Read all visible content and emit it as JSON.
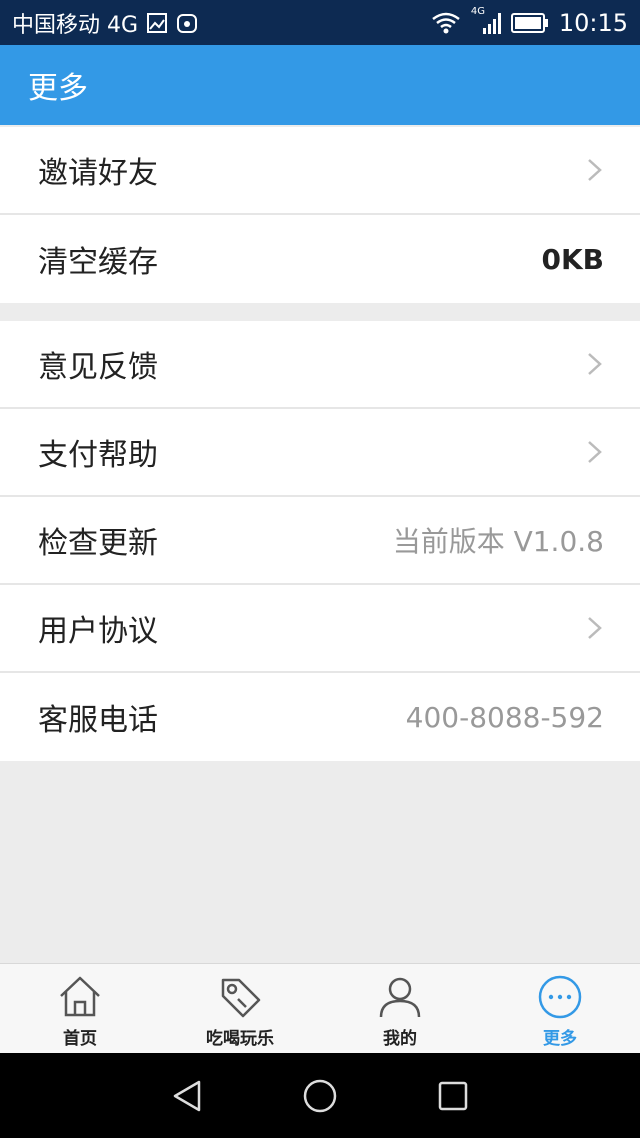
{
  "status_bar": {
    "carrier": "中国移动 4G",
    "time": "10:15",
    "net_small": "4G",
    "icons": [
      "image-icon",
      "app-notification-icon",
      "wifi-icon",
      "signal-icon",
      "battery-icon"
    ]
  },
  "header": {
    "title": "更多"
  },
  "groups": [
    {
      "rows": [
        {
          "label": "邀请好友",
          "value": "",
          "chevron": true
        },
        {
          "label": "清空缓存",
          "value": "0KB",
          "chevron": false
        }
      ]
    },
    {
      "rows": [
        {
          "label": "意见反馈",
          "value": "",
          "chevron": true
        },
        {
          "label": "支付帮助",
          "value": "",
          "chevron": true
        },
        {
          "label": "检查更新",
          "value": "当前版本 V1.0.8",
          "chevron": false
        },
        {
          "label": "用户协议",
          "value": "",
          "chevron": true
        },
        {
          "label": "客服电话",
          "value": "400-8088-592",
          "chevron": false
        }
      ]
    }
  ],
  "tabbar": {
    "tabs": [
      {
        "label": "首页",
        "icon": "home-icon",
        "active": false
      },
      {
        "label": "吃喝玩乐",
        "icon": "tag-icon",
        "active": false
      },
      {
        "label": "我的",
        "icon": "user-icon",
        "active": false
      },
      {
        "label": "更多",
        "icon": "more-icon",
        "active": true
      }
    ]
  },
  "colors": {
    "accent": "#3399e6",
    "status_bar": "#0d2a52",
    "background": "#ececec"
  }
}
